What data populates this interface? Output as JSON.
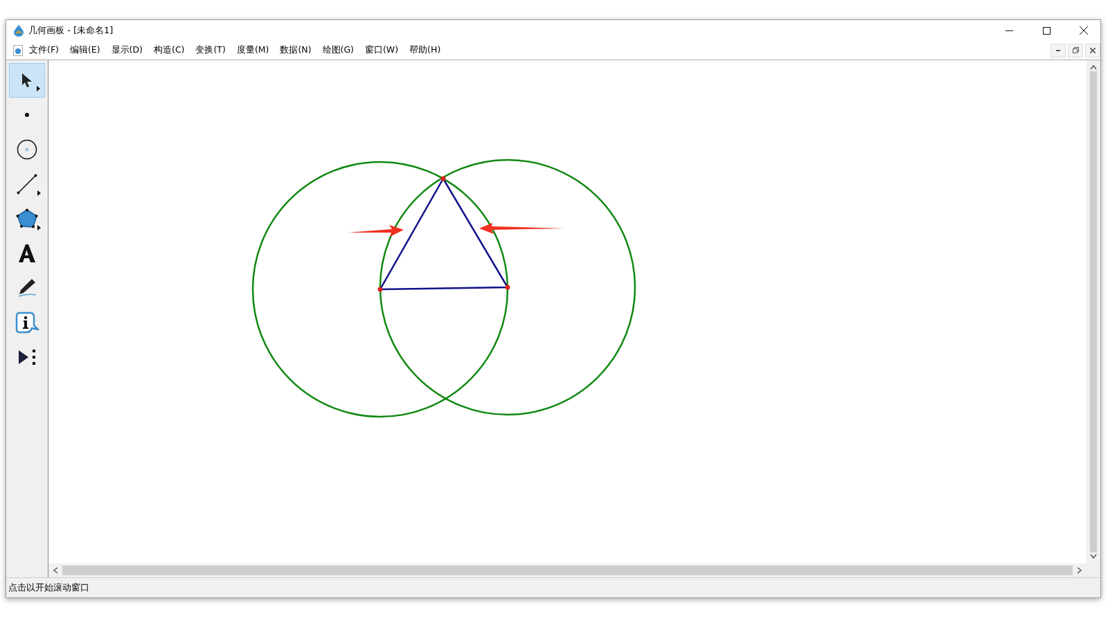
{
  "window": {
    "title": "几何画板 - [未命名1]"
  },
  "menu": [
    "文件(F)",
    "编辑(E)",
    "显示(D)",
    "构造(C)",
    "变换(T)",
    "度量(M)",
    "数据(N)",
    "绘图(G)",
    "窗口(W)",
    "帮助(H)"
  ],
  "tools": [
    {
      "kind": "selection",
      "selected": true,
      "submenu": true
    },
    {
      "kind": "point",
      "selected": false,
      "submenu": false
    },
    {
      "kind": "compass",
      "selected": false,
      "submenu": false
    },
    {
      "kind": "straightedge",
      "selected": false,
      "submenu": true
    },
    {
      "kind": "polygon",
      "selected": false,
      "submenu": true
    },
    {
      "kind": "text",
      "selected": false,
      "submenu": false
    },
    {
      "kind": "marker",
      "selected": false,
      "submenu": false
    },
    {
      "kind": "information",
      "selected": false,
      "submenu": false
    },
    {
      "kind": "custom",
      "selected": false,
      "submenu": false
    }
  ],
  "status_bar": "点击以开始滚动窗口"
}
